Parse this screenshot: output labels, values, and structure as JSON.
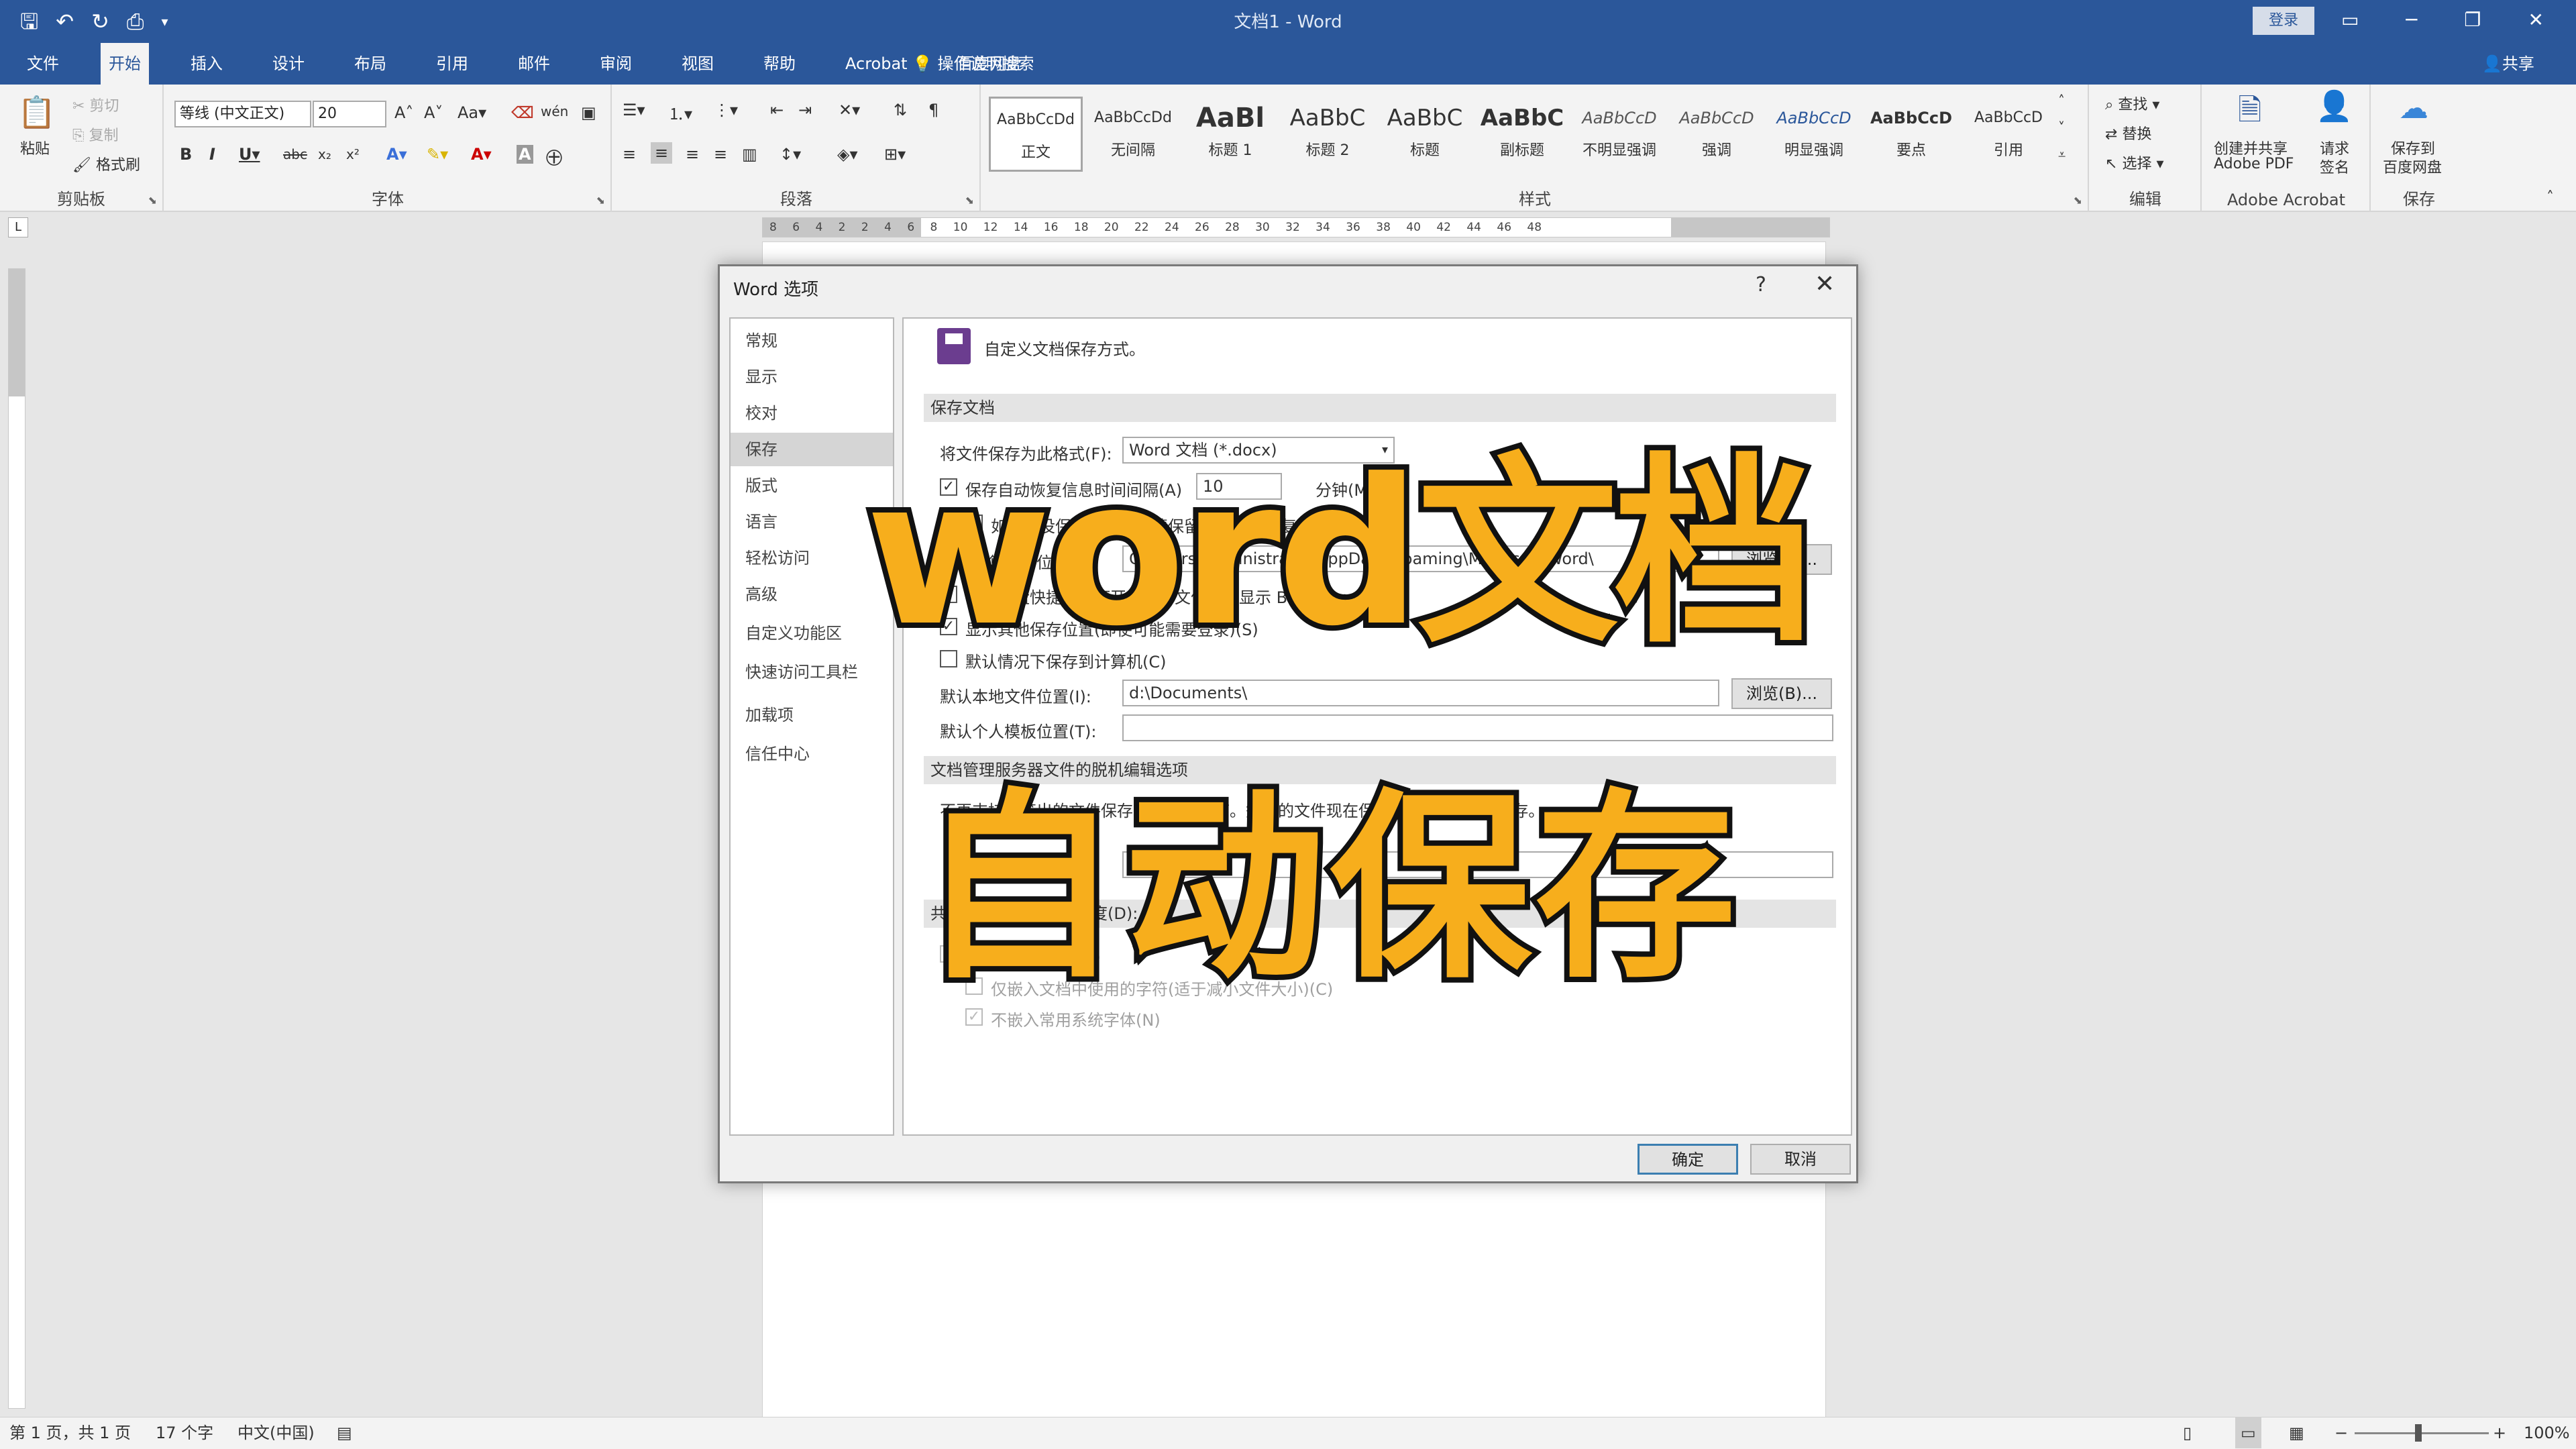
{
  "titlebar": {
    "doc_title": "文档1 - Word",
    "login": "登录",
    "qat_icons": [
      "save-icon",
      "undo-icon",
      "redo-icon",
      "print-preview-icon",
      "customize-qat-icon"
    ]
  },
  "tabs": {
    "items": [
      "文件",
      "开始",
      "插入",
      "设计",
      "布局",
      "引用",
      "邮件",
      "审阅",
      "视图",
      "帮助",
      "Acrobat",
      "百度网盘"
    ],
    "tell_me": "操作说明搜索",
    "share": "共享"
  },
  "ribbon": {
    "clipboard": {
      "label": "剪贴板",
      "paste": "粘贴",
      "cut": "剪切",
      "copy": "复制",
      "format_painter": "格式刷"
    },
    "font": {
      "label": "字体",
      "font_name": "等线 (中文正文)",
      "font_size": "20"
    },
    "paragraph": {
      "label": "段落"
    },
    "styles": {
      "label": "样式",
      "items": [
        {
          "preview": "AaBbCcDd",
          "name": "正文"
        },
        {
          "preview": "AaBbCcDd",
          "name": "无间隔"
        },
        {
          "preview": "AaBl",
          "name": "标题 1"
        },
        {
          "preview": "AaBbC",
          "name": "标题 2"
        },
        {
          "preview": "AaBbC",
          "name": "标题"
        },
        {
          "preview": "AaBbC",
          "name": "副标题"
        },
        {
          "preview": "AaBbCcD",
          "name": "不明显强调"
        },
        {
          "preview": "AaBbCcD",
          "name": "强调"
        },
        {
          "preview": "AaBbCcD",
          "name": "明显强调"
        },
        {
          "preview": "AaBbCcD",
          "name": "要点"
        },
        {
          "preview": "AaBbCcD",
          "name": "引用"
        }
      ]
    },
    "editing": {
      "label": "编辑",
      "find": "查找",
      "replace": "替换",
      "select": "选择"
    },
    "acrobat": {
      "label": "Adobe Acrobat",
      "create_share": "创建并共享",
      "create_share2": "Adobe PDF",
      "request": "请求",
      "request2": "签名"
    },
    "save": {
      "label": "保存",
      "save_to": "保存到",
      "save_to2": "百度网盘"
    }
  },
  "ruler": {
    "numbers": "8  6  4  2        2  4  6  8  10  12  14  16  18  20  22  24  26  28  30  32  34  36  38  40  42  44  46  48"
  },
  "dialog": {
    "title": "Word 选项",
    "help": "?",
    "close": "✕",
    "nav": [
      "常规",
      "显示",
      "校对",
      "保存",
      "版式",
      "语言",
      "轻松访问",
      "高级",
      "自定义功能区",
      "快速访问工具栏",
      "加载项",
      "信任中心"
    ],
    "active_nav": "保存",
    "header": "自定义文档保存方式。",
    "section_save": "保存文档",
    "format_label": "将文件保存为此格式(F):",
    "format_value": "Word 文档 (*.docx)",
    "autorecover_label": "保存自动恢复信息时间间隔(A)",
    "autorecover_value": "10",
    "autorecover_unit": "分钟(M)",
    "keep_last": "如果我没保存就关闭，请保留上次自动恢复的版本",
    "autorecover_loc_label": "自动恢复文件位置(R):",
    "autorecover_loc_value": "C:\\Users\\Administrator\\AppData\\Roaming\\Microsoft\\Word\\",
    "browse": "浏览(B)...",
    "no_show_backstage": "使用键盘快捷方式打开或保存文件时不显示 Backstage(S)",
    "show_other": "显示其他保存位置(即使可能需要登录)(S)",
    "default_computer": "默认情况下保存到计算机(C)",
    "default_local_label": "默认本地文件位置(I):",
    "default_local_value": "d:\\Documents\\",
    "default_template_label": "默认个人模板位置(T):",
    "default_template_value": "",
    "section_offline": "文档管理服务器文件的脱机编辑选项",
    "offline_text": "不再支持将签出的文件保存到服务器草稿。签出的文件现在保存到 Office 文档缓存。",
    "section_fidelity": "共享该文档时保留保真度(D):",
    "embed_fonts": "将字体嵌入文件(E)",
    "embed_only_used": "仅嵌入文档中使用的字符(适于减小文件大小)(C)",
    "no_common_fonts": "不嵌入常用系统字体(N)",
    "ok": "确定",
    "cancel": "取消"
  },
  "overlay": {
    "line1": "word文档",
    "line2": "自动保存",
    "color": "#f7ae1c"
  },
  "status": {
    "page": "第 1 页，共 1 页",
    "words": "17 个字",
    "lang": "中文(中国)",
    "zoom": "100%"
  },
  "colors": {
    "accent": "#2b579a",
    "overlay_text": "#f7ae1c"
  }
}
